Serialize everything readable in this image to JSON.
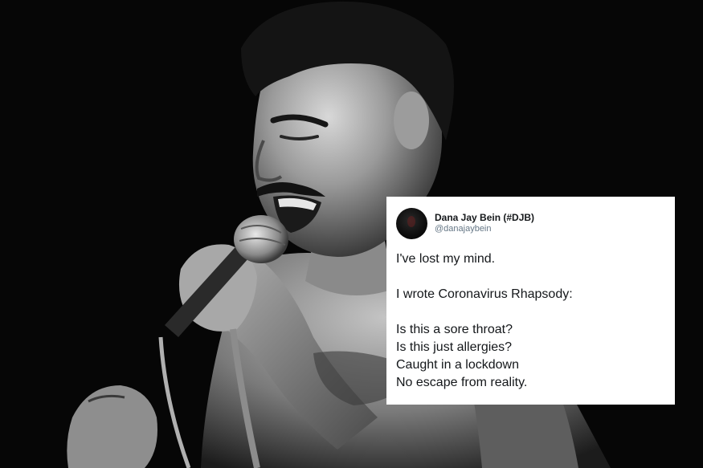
{
  "tweet": {
    "display_name": "Dana Jay Bein (#DJB)",
    "handle": "@danajaybein",
    "line_1": "I've lost my mind.",
    "line_2": "I wrote Coronavirus Rhapsody:",
    "line_3": "Is this a sore throat?",
    "line_4": "Is this just allergies?",
    "line_5": "Caught in a lockdown",
    "line_6": "No escape from reality."
  },
  "colors": {
    "background": "#000000",
    "card": "#ffffff",
    "text": "#14171a",
    "handle": "#657786"
  },
  "icons": {
    "avatar": "profile-photo"
  }
}
